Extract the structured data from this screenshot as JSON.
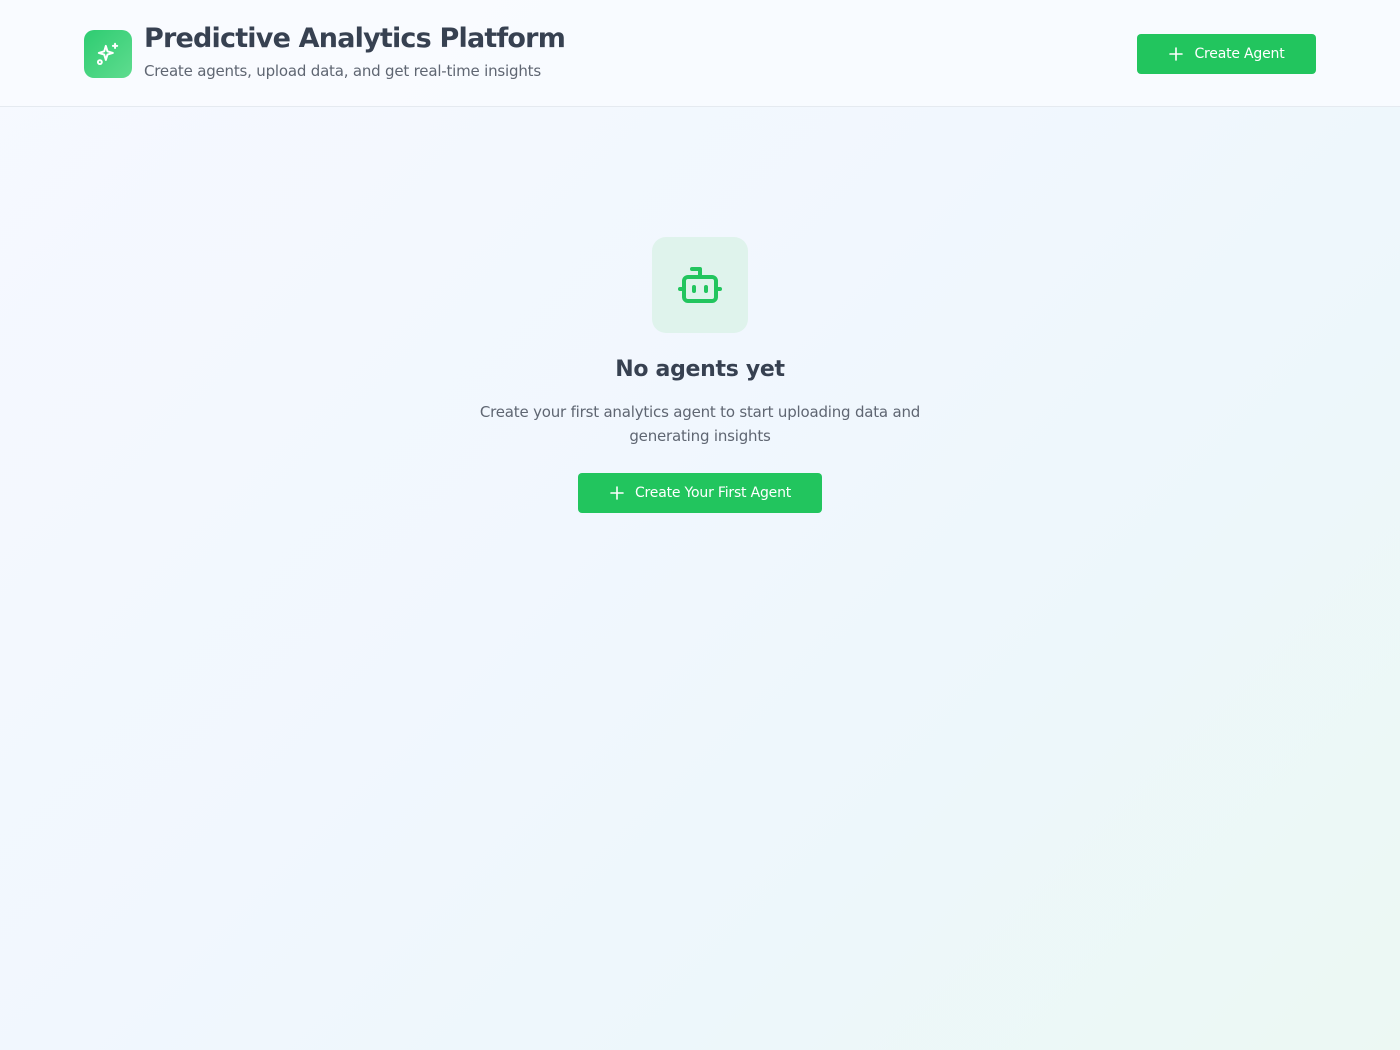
{
  "header": {
    "logo_icon": "sparkles-icon",
    "title": "Predictive Analytics Platform",
    "subtitle": "Create agents, upload data, and get real-time insights",
    "create_button_label": "Create Agent",
    "create_button_icon": "plus-icon"
  },
  "empty_state": {
    "icon": "bot-icon",
    "title": "No agents yet",
    "description": "Create your first analytics agent to start uploading data and generating insights",
    "cta_label": "Create Your First Agent",
    "cta_icon": "plus-icon"
  },
  "colors": {
    "accent": "#22c55e",
    "accent_light": "#dff3ec",
    "text_primary": "#374151",
    "text_secondary": "#5f6672"
  }
}
